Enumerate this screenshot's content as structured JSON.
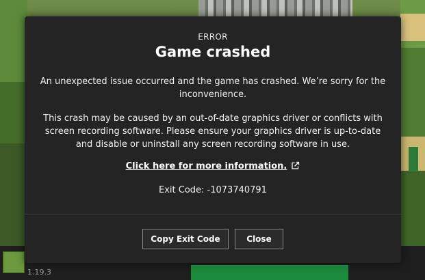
{
  "background": {
    "version": "1.19.3"
  },
  "dialog": {
    "eyebrow": "ERROR",
    "title": "Game crashed",
    "paragraph_1": "An unexpected issue occurred and the game has crashed. We’re sorry for the inconvenience.",
    "paragraph_2": "This crash may be caused by an out-of-date graphics driver or conflicts with screen recording software. Please ensure your graphics driver is up-to-date and disable or uninstall any screen recording software in use.",
    "link_text": "Click here for more information.",
    "link_icon": "external-link-icon",
    "exit_code": "Exit Code: -1073740791",
    "buttons": {
      "copy_label": "Copy Exit Code",
      "close_label": "Close"
    }
  },
  "colors": {
    "dialog_background": "#242424",
    "button_border": "#8a8a8a",
    "text": "#ffffff"
  }
}
